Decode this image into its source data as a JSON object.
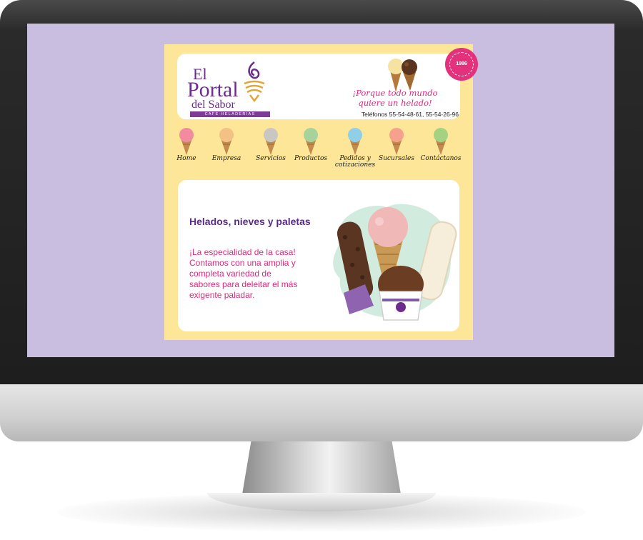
{
  "header": {
    "logo": {
      "line1": "El",
      "line2": "Portal",
      "line3": "del Sabor",
      "tagline": "CAFE·HELADERIAS"
    },
    "badge_year": "1986",
    "slogan": "¡Porque todo mundo quiere un helado!",
    "phones": "Teléfonos 55-54-48-61, 55-54-26-96"
  },
  "nav": {
    "items": [
      {
        "label": "Home",
        "color": "#f48aa0"
      },
      {
        "label": "Empresa",
        "color": "#f3c183"
      },
      {
        "label": "Servicios",
        "color": "#c9c7c4"
      },
      {
        "label": "Productos",
        "color": "#a6d39c"
      },
      {
        "label": "Pedidos y cotizaciones",
        "color": "#8fd0e8"
      },
      {
        "label": "Sucursales",
        "color": "#f6a08e"
      },
      {
        "label": "Contáctanos",
        "color": "#a3d282"
      }
    ]
  },
  "content": {
    "title": "Helados, nieves y paletas",
    "body": "¡La especialidad de la casa! Contamos con una amplia y completa variedad de sabores para deleitar el más exigente paladar."
  },
  "colors": {
    "screen_bg": "#c9bde0",
    "site_bg": "#fde697",
    "brand_purple": "#6b2c8c",
    "accent_pink": "#e0277c"
  }
}
